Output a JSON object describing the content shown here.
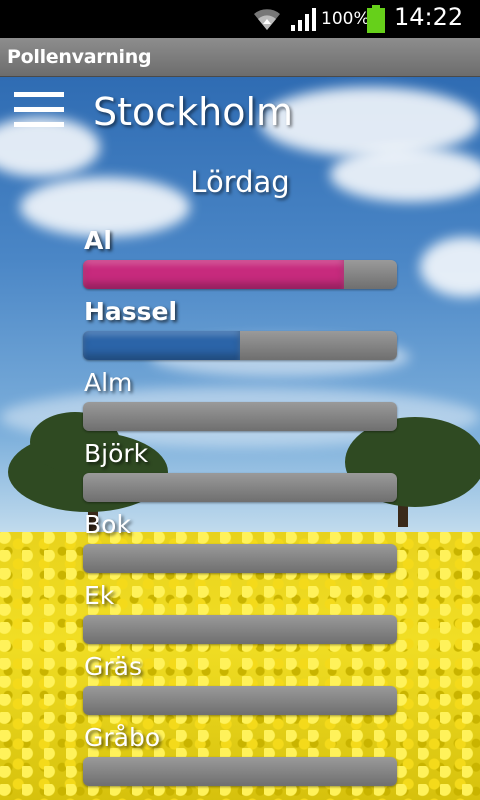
{
  "status_bar": {
    "battery": "100%",
    "time": "14:22"
  },
  "app": {
    "title": "Pollenvarning"
  },
  "header": {
    "city": "Stockholm",
    "day": "Lördag"
  },
  "pollen": [
    {
      "name": "Al",
      "level": 0.83,
      "color": "#c72a7d",
      "emphasized": true
    },
    {
      "name": "Hassel",
      "level": 0.5,
      "color": "#2b64a8",
      "emphasized": true
    },
    {
      "name": "Alm",
      "level": 0,
      "color": "#808080",
      "emphasized": false
    },
    {
      "name": "Björk",
      "level": 0,
      "color": "#808080",
      "emphasized": false
    },
    {
      "name": "Bok",
      "level": 0,
      "color": "#808080",
      "emphasized": false
    },
    {
      "name": "Ek",
      "level": 0,
      "color": "#808080",
      "emphasized": false
    },
    {
      "name": "Gräs",
      "level": 0,
      "color": "#808080",
      "emphasized": false
    },
    {
      "name": "Gråbo",
      "level": 0,
      "color": "#808080",
      "emphasized": false
    }
  ]
}
